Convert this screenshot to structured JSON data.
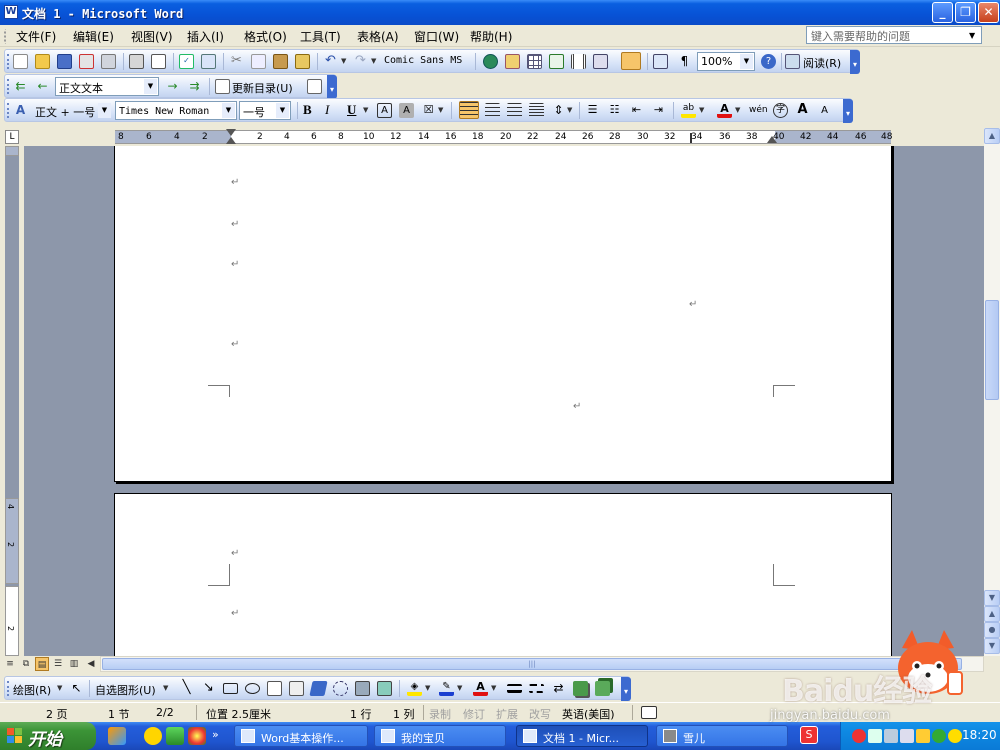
{
  "window": {
    "title": "文档 1 - Microsoft Word",
    "icon": "word-doc-icon",
    "buttons": [
      "minimize",
      "restore",
      "close"
    ]
  },
  "menubar": {
    "items": [
      "文件(F)",
      "编辑(E)",
      "视图(V)",
      "插入(I)",
      "格式(O)",
      "工具(T)",
      "表格(A)",
      "窗口(W)",
      "帮助(H)"
    ],
    "help_placeholder": "键入需要帮助的问题"
  },
  "standard_toolbar": {
    "font_preview": "Comic Sans MS",
    "zoom": "100%",
    "read_label": "阅读(R)"
  },
  "outline_toolbar": {
    "style_value": "正文文本",
    "update_toc_label": "更新目录(U)"
  },
  "format_toolbar": {
    "style_value": "正文 + 一号",
    "font_value": "Times New Roman",
    "size_value": "一号",
    "bold": "B",
    "italic": "I",
    "underline": "U"
  },
  "ruler": {
    "tab_selector": "L",
    "ticks": [
      "8",
      "6",
      "4",
      "2",
      "2",
      "4",
      "6",
      "8",
      "10",
      "12",
      "14",
      "16",
      "18",
      "20",
      "22",
      "24",
      "26",
      "28",
      "30",
      "32",
      "34",
      "36",
      "38",
      "40",
      "42",
      "44",
      "46",
      "48"
    ],
    "vticks": [
      "4",
      "2",
      "2"
    ]
  },
  "document": {
    "paragraph_mark": "↵"
  },
  "draw_toolbar": {
    "draw_label": "绘图(R)",
    "autoshape_label": "自选图形(U)"
  },
  "statusbar": {
    "page": "2 页",
    "section": "1 节",
    "page_of": "2/2",
    "position": "位置 2.5厘米",
    "line": "1 行",
    "column": "1 列",
    "rec": "录制",
    "trk": "修订",
    "ext": "扩展",
    "ovr": "改写",
    "lang": "英语(美国)"
  },
  "taskbar": {
    "start_label": "开始",
    "tasks": [
      "Word基本操作...",
      "我的宝贝",
      "文档 1 - Micr...",
      "雪儿"
    ],
    "clock": "18:20"
  },
  "watermark": {
    "brand": "Baidu经验",
    "url": "jingyan.baidu.com"
  },
  "colors": {
    "title_blue": "#0a5fe0",
    "doc_bg": "#8d97aa",
    "taskbar_blue": "#245edb",
    "start_green": "#3c9437"
  }
}
